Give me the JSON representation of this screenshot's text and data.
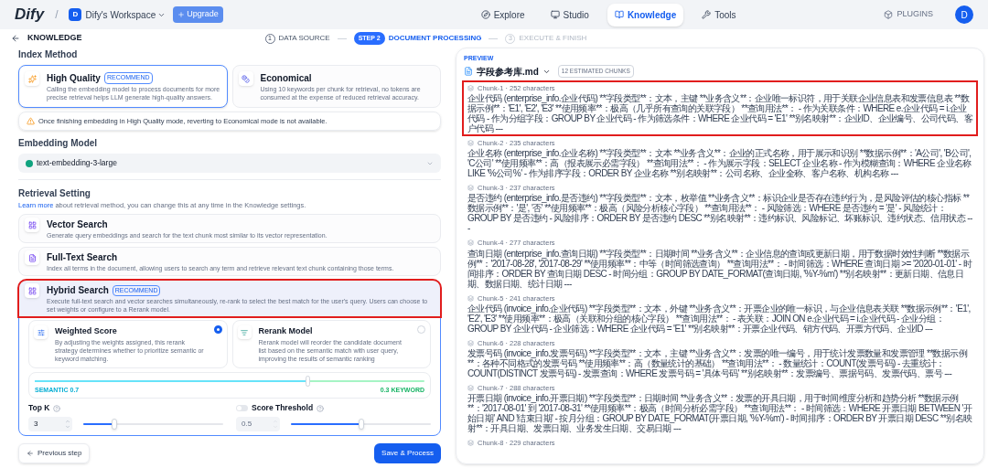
{
  "nav": {
    "logo": "Dify",
    "workspace_initial": "D",
    "separator": "/",
    "workspace": "Dify's Workspace",
    "upgrade": "Upgrade",
    "tabs": [
      {
        "kind": "explore",
        "label": "Explore",
        "selected": false
      },
      {
        "kind": "studio",
        "label": "Studio",
        "selected": false
      },
      {
        "kind": "knowledge",
        "label": "Knowledge",
        "selected": true
      },
      {
        "kind": "tools",
        "label": "Tools",
        "selected": false
      }
    ],
    "plugins": "PLUGINS",
    "avatar": "D"
  },
  "back_label": "KNOWLEDGE",
  "steps": [
    {
      "number": "1",
      "label": "DATA SOURCE",
      "selected": false,
      "completed": true
    },
    {
      "number": "STEP 2",
      "label": "DOCUMENT PROCESSING",
      "selected": true,
      "completed": false
    },
    {
      "number": "3",
      "label": "EXECUTE & FINISH",
      "selected": false,
      "completed": false
    }
  ],
  "index_method": {
    "title": "Index Method",
    "options": [
      {
        "kind": "high-quality",
        "title": "High Quality",
        "badge": "RECOMMEND",
        "description": "Calling the embedding model to process documents for more precise retrieval helps LLM generate high-quality answers.",
        "selected": true
      },
      {
        "kind": "economical",
        "title": "Economical",
        "description": "Using 10 keywords per chunk for retrieval, no tokens are consumed at the expense of reduced retrieval accuracy.",
        "selected": false
      }
    ],
    "warning": "Once finishing embedding in High Quality mode, reverting to Economical mode is not available."
  },
  "embedding_model": {
    "title": "Embedding Model",
    "value": "text-embedding-3-large"
  },
  "retrieval": {
    "title": "Retrieval Setting",
    "link": "Learn more",
    "note": "about retrieval method, you can change this at any time in the Knowledge settings.",
    "options": [
      {
        "kind": "vector",
        "title": "Vector Search",
        "description": "Generate query embeddings and search for the text chunk most similar to its vector representation.",
        "selected": false,
        "annotated": false
      },
      {
        "kind": "fulltext",
        "title": "Full-Text Search",
        "description": "Index all terms in the document, allowing users to search any term and retrieve relevant text chunk containing those terms.",
        "selected": false,
        "annotated": false
      },
      {
        "kind": "hybrid",
        "title": "Hybrid Search",
        "badge": "RECOMMEND",
        "description": "Execute full-text search and vector searches simultaneously, re-rank to select the best match for the user's query. Users can choose to set weights or configure to a Rerank model.",
        "selected": true,
        "annotated": true
      }
    ],
    "rerank_options": [
      {
        "kind": "weighted",
        "title": "Weighted Score",
        "description": "By adjusting the weights assigned, this rerank strategy determines whether to prioritize semantic or keyword matching.",
        "selected": true
      },
      {
        "kind": "rerank",
        "title": "Rerank Model",
        "description": "Rerank model will reorder the candidate document list based on the semantic match with user query, improving the results of semantic ranking",
        "selected": false
      }
    ],
    "weights": {
      "level": 0.7,
      "left_label": "SEMANTIC 0.7",
      "right_label": "0.3 KEYWORD"
    },
    "top_k": {
      "label": "Top K",
      "value": "3",
      "level": 0.22
    },
    "score_threshold": {
      "label": "Score Threshold",
      "on": false,
      "value": "0.5",
      "level": 0.5
    }
  },
  "buttons": {
    "previous": "Previous step",
    "save": "Save & Process"
  },
  "preview": {
    "label": "PREVIEW",
    "file": "字段参考库.md",
    "count": "12 ESTIMATED CHUNKS",
    "chunks": [
      {
        "header": "Chunk-1 · 252 characters",
        "annotated": true,
        "text": "企业代码 (enterprise_info.企业代码) **字段类型**：文本，主键 **业务含义**：企业唯一标识符，用于关联企业信息表和发票信息表 **数据示例**：'E1', 'E2', 'E3' **使用频率**：极高（几乎所有查询的关联字段） **查询用法**： - 作为关联条件：WHERE e.企业代码 = i.企业代码 - 作为分组字段：GROUP BY 企业代码 - 作为筛选条件：WHERE 企业代码 = 'E1' **别名映射**：企业ID、企业编号、公司代码、客户代码 ---"
      },
      {
        "header": "Chunk-2 · 235 characters",
        "annotated": false,
        "text": "企业名称 (enterprise_info.企业名称) **字段类型**：文本 **业务含义**：企业的正式名称，用于展示和识别 **数据示例**：'A公司', 'B公司', 'C公司' **使用频率**：高（报表展示必需字段） **查询用法**： - 作为展示字段：SELECT 企业名称 - 作为模糊查询：WHERE 企业名称 LIKE '%公司%' - 作为排序字段：ORDER BY 企业名称 **别名映射**：公司名称、企业全称、客户名称、机构名称 ---"
      },
      {
        "header": "Chunk-3 · 237 characters",
        "annotated": false,
        "text": "是否违约 (enterprise_info.是否违约) **字段类型**：文本，枚举值 **业务含义**：标识企业是否存在违约行为，是风险评估的核心指标 **数据示例**：'是', '否' **使用频率**：极高（风险分析核心字段） **查询用法**： - 风险筛选：WHERE 是否违约 = '是' - 风险统计：GROUP BY 是否违约 - 风险排序：ORDER BY 是否违约 DESC **别名映射**：违约标识、风险标记、坏账标识、违约状态、信用状态 ---"
      },
      {
        "header": "Chunk-4 · 277 characters",
        "annotated": false,
        "text": "查询日期 (enterprise_info.查询日期) **字段类型**：日期时间 **业务含义**：企业信息的查询或更新日期，用于数据时效性判断 **数据示例**：'2017-08-28', '2017-08-29' **使用频率**：中等（时间筛选查询） **查询用法**： - 时间筛选：WHERE 查询日期 >= '2020-01-01' - 时间排序：ORDER BY 查询日期 DESC - 时间分组：GROUP BY DATE_FORMAT(查询日期, '%Y-%m') **别名映射**：更新日期、信息日期、数据日期、统计日期 ---"
      },
      {
        "header": "Chunk-5 · 241 characters",
        "annotated": false,
        "text": "企业代码 (invoice_info.企业代码) **字段类型**：文本，外键 **业务含义**：开票企业的唯一标识，与企业信息表关联 **数据示例**：'E1', 'E2', 'E3' **使用频率**：极高（关联和分组的核心字段） **查询用法**： - 表关联：JOIN ON e.企业代码 = i.企业代码 - 企业分组：GROUP BY 企业代码 - 企业筛选：WHERE 企业代码 = 'E1' **别名映射**：开票企业代码、销方代码、开票方代码、企业ID ---"
      },
      {
        "header": "Chunk-6 · 228 characters",
        "annotated": false,
        "text": "发票号码 (invoice_info.发票号码) **字段类型**：文本，主键 **业务含义**：发票的唯一编号，用于统计发票数量和发票管理 **数据示例**：各种不同格式的发票号码 **使用频率**：高（数量统计的基础） **查询用法**： - 数量统计：COUNT(发票号码) - 去重统计：COUNT(DISTINCT 发票号码) - 发票查询：WHERE 发票号码 = '具体号码' **别名映射**：发票编号、票据号码、发票代码、票号 ---"
      },
      {
        "header": "Chunk-7 · 288 characters",
        "annotated": false,
        "text": "开票日期 (invoice_info.开票日期) **字段类型**：日期时间 **业务含义**：发票的开具日期，用于时间维度分析和趋势分析 **数据示例**：'2017-08-01' 到 '2017-08-31' **使用频率**：极高（时间分析必需字段） **查询用法**： - 时间筛选：WHERE 开票日期 BETWEEN '开始日期' AND '结束日期' - 按月分组：GROUP BY DATE_FORMAT(开票日期, '%Y-%m') - 时间排序：ORDER BY 开票日期 DESC **别名映射**：开具日期、发票日期、业务发生日期、交易日期 ---"
      },
      {
        "header": "Chunk-8 · 229 characters",
        "annotated": false
      }
    ]
  }
}
